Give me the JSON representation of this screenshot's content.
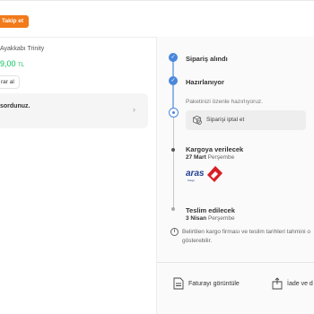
{
  "header": {
    "follow_label": "Takip et"
  },
  "product": {
    "name": "Ayakkabı Trinity",
    "price": "9,00",
    "currency": "TL",
    "buy_again_label": "rar al"
  },
  "question": {
    "text": "sordunuz."
  },
  "timeline": {
    "steps": [
      {
        "title": "Sipariş alındı",
        "status": "done"
      },
      {
        "title": "Hazırlanıyor",
        "status": "current",
        "note": "Paketinizi özenle hazırlıyoruz.",
        "action_label": "Siparişi iptal et"
      },
      {
        "title": "Kargoya verilecek",
        "date": "27 Mart",
        "day": "Perşembe",
        "status": "pending"
      },
      {
        "title": "Teslim edilecek",
        "date": "3 Nisan",
        "day": "Perşembe",
        "status": "pending"
      }
    ]
  },
  "cargo": {
    "brand": "aras",
    "tagline": "Kargo"
  },
  "info": {
    "line1": "Belirtilen kargo firması ve teslim tarihleri tahmini o",
    "line2": "gösterebilir."
  },
  "footer": {
    "invoice_label": "Faturayı görüntüle",
    "return_label": "İade ve d"
  },
  "colors": {
    "accent": "#f27a1a",
    "price": "#0bc15c",
    "timeline": "#4a87db"
  }
}
